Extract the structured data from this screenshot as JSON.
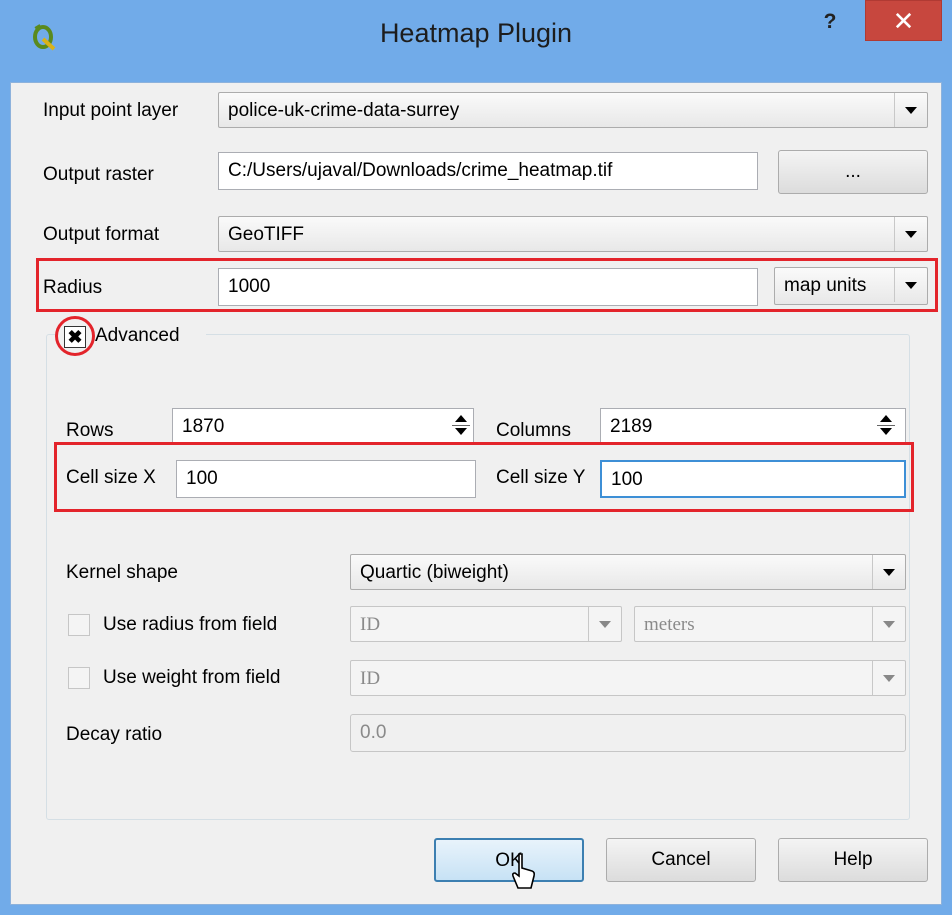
{
  "window": {
    "title": "Heatmap Plugin",
    "help_label": "?",
    "close_label": "✕"
  },
  "colors": {
    "title_bar": "#71abe9",
    "close_button": "#c7473e",
    "highlight": "#e3242b"
  },
  "fields": {
    "input_point_layer": {
      "label": "Input point layer",
      "value": "police-uk-crime-data-surrey"
    },
    "output_raster": {
      "label": "Output raster",
      "value": "C:/Users/ujaval/Downloads/crime_heatmap.tif",
      "browse_label": "..."
    },
    "output_format": {
      "label": "Output format",
      "value": "GeoTIFF"
    },
    "radius": {
      "label": "Radius",
      "value": "1000",
      "unit": "map units"
    }
  },
  "advanced": {
    "title": "Advanced",
    "checked": true,
    "check_glyph": "✖",
    "rows": {
      "label": "Rows",
      "value": "1870"
    },
    "columns": {
      "label": "Columns",
      "value": "2189"
    },
    "cell_size_x": {
      "label": "Cell size X",
      "value": "100"
    },
    "cell_size_y": {
      "label": "Cell size Y",
      "value": "100"
    },
    "kernel_shape": {
      "label": "Kernel shape",
      "value": "Quartic (biweight)"
    },
    "use_radius_from_field": {
      "label": "Use radius from field",
      "checked": false,
      "field": "ID",
      "unit": "meters"
    },
    "use_weight_from_field": {
      "label": "Use weight from field",
      "checked": false,
      "field": "ID"
    },
    "decay_ratio": {
      "label": "Decay ratio",
      "value": "0.0"
    }
  },
  "buttons": {
    "ok": "OK",
    "cancel": "Cancel",
    "help": "Help"
  }
}
